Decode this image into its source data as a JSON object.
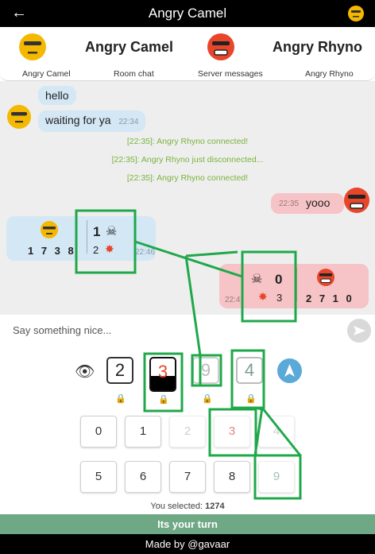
{
  "header": {
    "back_label": "←",
    "title": "Angry Camel"
  },
  "players": {
    "left_name": "Angry Camel",
    "right_name": "Angry Rhyno"
  },
  "tabs": [
    "Angry Camel",
    "Room chat",
    "Server messages",
    "Angry Rhyno"
  ],
  "chat": {
    "my_messages": [
      {
        "text": "hello"
      },
      {
        "text": "waiting for ya",
        "time": "22:34"
      }
    ],
    "system": [
      "[22:35]: Angry Rhyno connected!",
      "[22:35]: Angry Rhyno just disconnected...",
      "[22:35]: Angry Rhyno connected!"
    ],
    "their_message": {
      "time": "22:35",
      "text": "yooo"
    },
    "my_guess": {
      "digits": "1 7 3 8",
      "dead": "1",
      "injured": "2",
      "time": "22:46"
    },
    "their_guess": {
      "digits": "2 7 1 0",
      "dead": "0",
      "injured": "3",
      "time": "22:4"
    }
  },
  "composer": {
    "placeholder": "Say something nice..."
  },
  "secret": [
    "2",
    "3",
    "9",
    "4"
  ],
  "keypad": [
    "0",
    "1",
    "2",
    "3",
    "4",
    "5",
    "6",
    "7",
    "8",
    "9"
  ],
  "selection": {
    "label": "You selected:",
    "value": "1274"
  },
  "status": {
    "turn_label": "Its your turn"
  },
  "footer": {
    "credit": "Made by @gavaar"
  },
  "colors": {
    "camel": "#f5b800",
    "rhyno": "#e8452b",
    "my_bubble": "#d3e7f5",
    "their_bubble": "#f6c3c6",
    "system_text": "#78b43c",
    "turn_bar": "#6fa885",
    "annotation": "#1fa84a"
  }
}
